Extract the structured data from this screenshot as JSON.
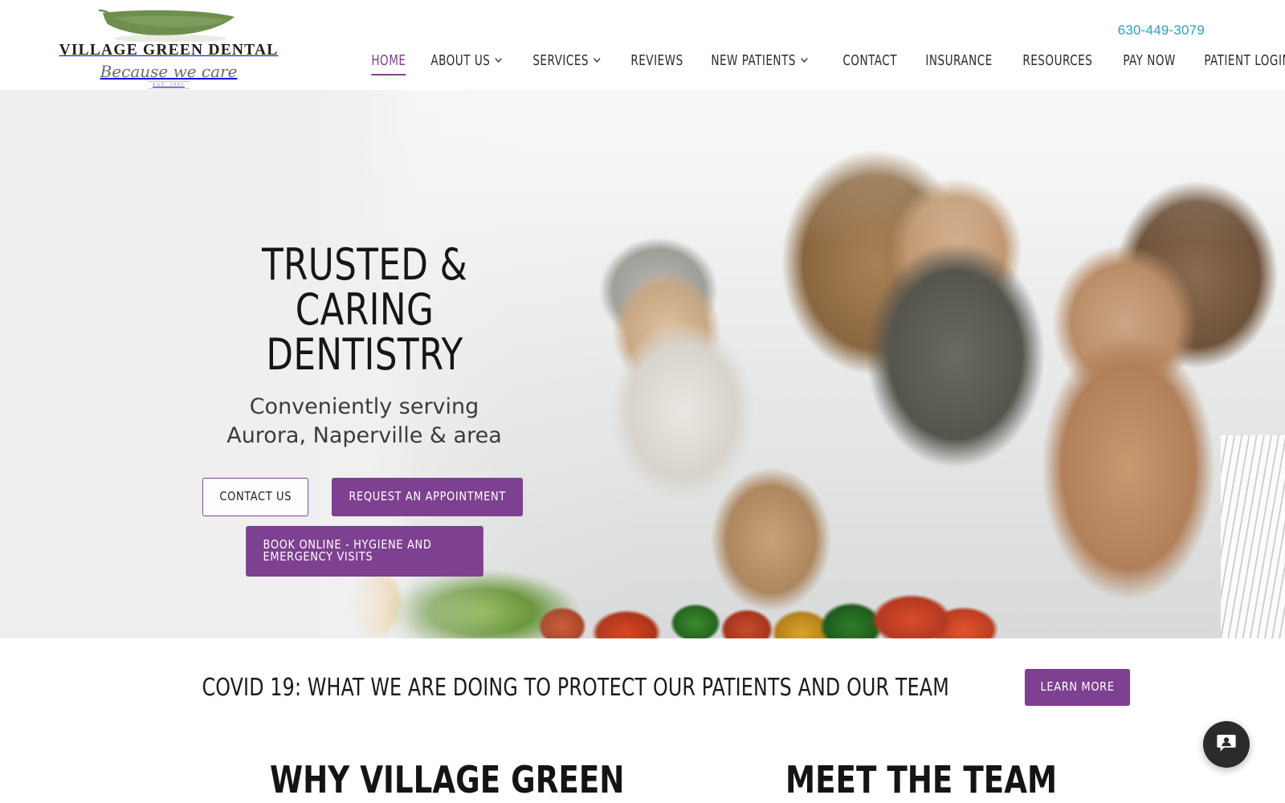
{
  "header": {
    "logo": {
      "name": "VILLAGE GREEN DENTAL",
      "tagline": "Because we care",
      "established": "EST. 1985",
      "leaf_color": "#6f8f4e"
    },
    "phone": "630-449-3079",
    "phone_color": "#2e9fc4",
    "nav": [
      {
        "label": "HOME",
        "active": true,
        "has_dropdown": false
      },
      {
        "label": "ABOUT US",
        "active": false,
        "has_dropdown": true
      },
      {
        "label": "SERVICES",
        "active": false,
        "has_dropdown": true
      },
      {
        "label": "REVIEWS",
        "active": false,
        "has_dropdown": false
      },
      {
        "label": "NEW PATIENTS",
        "active": false,
        "has_dropdown": true
      },
      {
        "label": "CONTACT",
        "active": false,
        "has_dropdown": false
      },
      {
        "label": "INSURANCE",
        "active": false,
        "has_dropdown": false
      },
      {
        "label": "RESOURCES",
        "active": false,
        "has_dropdown": false
      },
      {
        "label": "PAY NOW",
        "active": false,
        "has_dropdown": false
      },
      {
        "label": "PATIENT LOGIN",
        "active": false,
        "has_dropdown": false
      }
    ]
  },
  "hero": {
    "title": "TRUSTED & CARING DENTISTRY",
    "subtitle": "Conveniently serving Aurora, Naperville & area",
    "buttons": {
      "contact": "CONTACT US",
      "request": "REQUEST AN APPOINTMENT",
      "book": "BOOK ONLINE - HYGIENE AND EMERGENCY VISITS"
    },
    "image_alt": "Multigenerational family preparing a salad together in a bright kitchen"
  },
  "covid_banner": {
    "text": "COVID 19: WHAT WE ARE DOING TO PROTECT OUR PATIENTS AND OUR TEAM",
    "button": "LEARN MORE"
  },
  "sections": {
    "why": "WHY VILLAGE GREEN",
    "team": "MEET THE TEAM"
  },
  "chat_widget": {
    "icon": "chat-person-icon"
  },
  "colors": {
    "accent_purple": "#7e4090",
    "phone_blue": "#2e9fc4",
    "logo_green": "#6f8f4e",
    "hero_bg": "#efefef",
    "text_dark": "#1a1a1a"
  }
}
